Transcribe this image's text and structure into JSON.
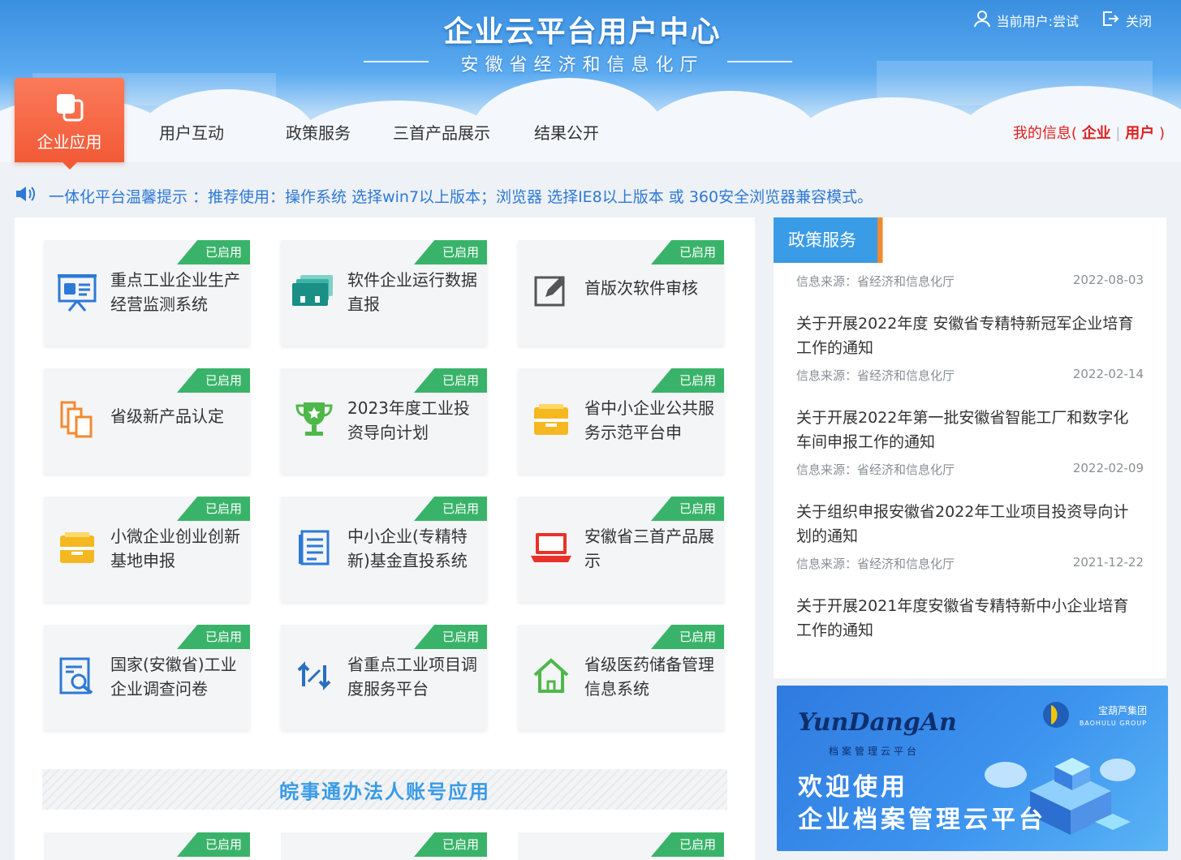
{
  "header": {
    "title": "企业云平台用户中心",
    "subtitle": "安徽省经济和信息化厅",
    "current_user": "当前用户:尝试",
    "close": "关闭"
  },
  "nav": {
    "active": "企业应用",
    "items": [
      "用户互动",
      "政策服务",
      "三首产品展示",
      "结果公开"
    ],
    "my_info": {
      "prefix": "我的信息(",
      "enterprise": "企业",
      "sep": "|",
      "user": "用户",
      "suffix": ")"
    }
  },
  "notice": {
    "text": "一体化平台温馨提示 ：推荐使用：操作系统 选择win7以上版本；浏览器 选择IE8以上版本 或 360安全浏览器兼容模式。"
  },
  "apps": [
    {
      "name": "重点工业企业生产经营监测系统",
      "badge": "已启用",
      "icon": "monitor-board-icon"
    },
    {
      "name": "软件企业运行数据直报",
      "badge": "已启用",
      "icon": "folders-icon"
    },
    {
      "name": "首版次软件审核",
      "badge": "已启用",
      "icon": "edit-icon"
    },
    {
      "name": "省级新产品认定",
      "badge": "已启用",
      "icon": "copy-icon"
    },
    {
      "name": "2023年度工业投资导向计划",
      "badge": "已启用",
      "icon": "trophy-icon"
    },
    {
      "name": "省中小企业公共服务示范平台申",
      "badge": "已启用",
      "icon": "tray-icon"
    },
    {
      "name": "小微企业创业创新基地申报",
      "badge": "已启用",
      "icon": "tray-icon"
    },
    {
      "name": "中小企业(专精特新)基金直投系统",
      "badge": "已启用",
      "icon": "document-icon"
    },
    {
      "name": "安徽省三首产品展示",
      "badge": "已启用",
      "icon": "laptop-icon"
    },
    {
      "name": "国家(安徽省)工业企业调查问卷",
      "badge": "已启用",
      "icon": "search-doc-icon"
    },
    {
      "name": "省重点工业项目调度服务平台",
      "badge": "已启用",
      "icon": "sync-icon"
    },
    {
      "name": "省级医药储备管理信息系统",
      "badge": "已启用",
      "icon": "home-icon"
    }
  ],
  "section2": {
    "title": "皖事通办法人账号应用",
    "badges": [
      "已启用",
      "已启用",
      "已启用"
    ]
  },
  "policy": {
    "tab": "政策服务",
    "first_source": {
      "source": "信息来源：省经济和信息化厅",
      "date": "2022-08-03"
    },
    "items": [
      {
        "title": "关于开展2022年度 安徽省专精特新冠军企业培育工作的通知",
        "source": "信息来源：省经济和信息化厅",
        "date": "2022-02-14"
      },
      {
        "title": "关于开展2022年第一批安徽省智能工厂和数字化车间申报工作的通知",
        "source": "信息来源：省经济和信息化厅",
        "date": "2022-02-09"
      },
      {
        "title": "关于组织申报安徽省2022年工业项目投资导向计划的通知",
        "source": "信息来源：省经济和信息化厅",
        "date": "2021-12-22"
      },
      {
        "title": "关于开展2021年度安徽省专精特新中小企业培育工作的通知",
        "source": "",
        "date": ""
      }
    ]
  },
  "banner": {
    "logo": "YunDangAn",
    "logo_sub": "档案管理云平台",
    "welcome": "欢迎使用",
    "platform": "企业档案管理云平台",
    "group_name": "宝葫芦集团",
    "group_en": "BAOHULU GROUP"
  },
  "colors": {
    "accent_blue": "#3a9be6",
    "badge_green": "#3ab36a",
    "nav_active": "#f25a36",
    "link_red": "#e02020"
  }
}
